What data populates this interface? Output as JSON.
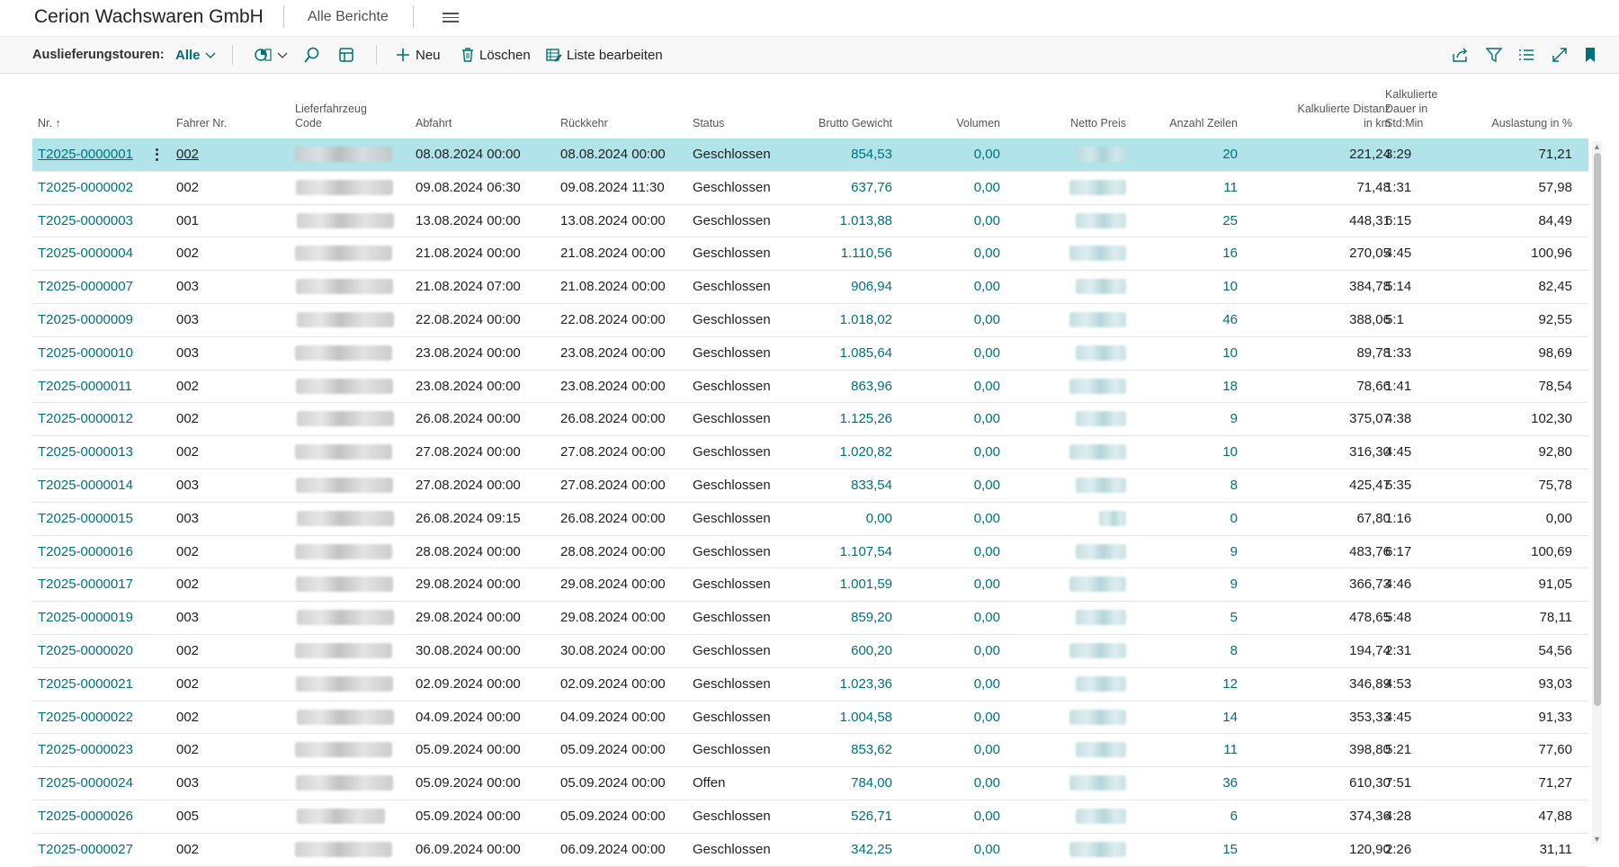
{
  "header": {
    "company": "Cerion Wachswaren GmbH",
    "reports_label": "Alle Berichte"
  },
  "actionbar": {
    "tours_label": "Auslieferungstouren:",
    "filter_value": "Alle",
    "new_label": "Neu",
    "delete_label": "Löschen",
    "edit_list_label": "Liste bearbeiten"
  },
  "columns": {
    "nr": "Nr.",
    "driver": "Fahrer Nr.",
    "vehicle_1": "Lieferfahrzeug",
    "vehicle_2": "Code",
    "departure": "Abfahrt",
    "return": "Rückkehr",
    "status": "Status",
    "gross_weight": "Brutto Gewicht",
    "volume": "Volumen",
    "net_price": "Netto Preis",
    "lines": "Anzahl Zeilen",
    "dist_1": "Kalkulierte Distanz",
    "dist_2": "in km",
    "dur_1": "Kalkulierte",
    "dur_2": "Dauer in",
    "dur_3": "Std:Min",
    "util": "Auslastung in %"
  },
  "rows": [
    {
      "nr": "T2025-0000001",
      "driver": "002",
      "dep": "08.08.2024 00:00",
      "ret": "08.08.2024 00:00",
      "status": "Geschlossen",
      "weight": "854,53",
      "vol": "0,00",
      "lines": "20",
      "dist": "221,24",
      "dur": "3:29",
      "util": "71,21"
    },
    {
      "nr": "T2025-0000002",
      "driver": "002",
      "dep": "09.08.2024 06:30",
      "ret": "09.08.2024 11:30",
      "status": "Geschlossen",
      "weight": "637,76",
      "vol": "0,00",
      "lines": "11",
      "dist": "71,48",
      "dur": "1:31",
      "util": "57,98"
    },
    {
      "nr": "T2025-0000003",
      "driver": "001",
      "dep": "13.08.2024 00:00",
      "ret": "13.08.2024 00:00",
      "status": "Geschlossen",
      "weight": "1.013,88",
      "vol": "0,00",
      "lines": "25",
      "dist": "448,31",
      "dur": "6:15",
      "util": "84,49"
    },
    {
      "nr": "T2025-0000004",
      "driver": "002",
      "dep": "21.08.2024 00:00",
      "ret": "21.08.2024 00:00",
      "status": "Geschlossen",
      "weight": "1.110,56",
      "vol": "0,00",
      "lines": "16",
      "dist": "270,05",
      "dur": "4:45",
      "util": "100,96"
    },
    {
      "nr": "T2025-0000007",
      "driver": "003",
      "dep": "21.08.2024 07:00",
      "ret": "21.08.2024 00:00",
      "status": "Geschlossen",
      "weight": "906,94",
      "vol": "0,00",
      "lines": "10",
      "dist": "384,78",
      "dur": "5:14",
      "util": "82,45"
    },
    {
      "nr": "T2025-0000009",
      "driver": "003",
      "dep": "22.08.2024 00:00",
      "ret": "22.08.2024 00:00",
      "status": "Geschlossen",
      "weight": "1.018,02",
      "vol": "0,00",
      "lines": "46",
      "dist": "388,06",
      "dur": "5:1",
      "util": "92,55"
    },
    {
      "nr": "T2025-0000010",
      "driver": "003",
      "dep": "23.08.2024 00:00",
      "ret": "23.08.2024 00:00",
      "status": "Geschlossen",
      "weight": "1.085,64",
      "vol": "0,00",
      "lines": "10",
      "dist": "89,78",
      "dur": "1:33",
      "util": "98,69"
    },
    {
      "nr": "T2025-0000011",
      "driver": "002",
      "dep": "23.08.2024 00:00",
      "ret": "23.08.2024 00:00",
      "status": "Geschlossen",
      "weight": "863,96",
      "vol": "0,00",
      "lines": "18",
      "dist": "78,66",
      "dur": "1:41",
      "util": "78,54"
    },
    {
      "nr": "T2025-0000012",
      "driver": "002",
      "dep": "26.08.2024 00:00",
      "ret": "26.08.2024 00:00",
      "status": "Geschlossen",
      "weight": "1.125,26",
      "vol": "0,00",
      "lines": "9",
      "dist": "375,07",
      "dur": "4:38",
      "util": "102,30"
    },
    {
      "nr": "T2025-0000013",
      "driver": "002",
      "dep": "27.08.2024 00:00",
      "ret": "27.08.2024 00:00",
      "status": "Geschlossen",
      "weight": "1.020,82",
      "vol": "0,00",
      "lines": "10",
      "dist": "316,30",
      "dur": "4:45",
      "util": "92,80"
    },
    {
      "nr": "T2025-0000014",
      "driver": "003",
      "dep": "27.08.2024 00:00",
      "ret": "27.08.2024 00:00",
      "status": "Geschlossen",
      "weight": "833,54",
      "vol": "0,00",
      "lines": "8",
      "dist": "425,47",
      "dur": "5:35",
      "util": "75,78"
    },
    {
      "nr": "T2025-0000015",
      "driver": "003",
      "dep": "26.08.2024 09:15",
      "ret": "26.08.2024 00:00",
      "status": "Geschlossen",
      "weight": "0,00",
      "vol": "0,00",
      "lines": "0",
      "dist": "67,80",
      "dur": "1:16",
      "util": "0,00"
    },
    {
      "nr": "T2025-0000016",
      "driver": "002",
      "dep": "28.08.2024 00:00",
      "ret": "28.08.2024 00:00",
      "status": "Geschlossen",
      "weight": "1.107,54",
      "vol": "0,00",
      "lines": "9",
      "dist": "483,76",
      "dur": "6:17",
      "util": "100,69"
    },
    {
      "nr": "T2025-0000017",
      "driver": "002",
      "dep": "29.08.2024 00:00",
      "ret": "29.08.2024 00:00",
      "status": "Geschlossen",
      "weight": "1.001,59",
      "vol": "0,00",
      "lines": "9",
      "dist": "366,73",
      "dur": "4:46",
      "util": "91,05"
    },
    {
      "nr": "T2025-0000019",
      "driver": "003",
      "dep": "29.08.2024 00:00",
      "ret": "29.08.2024 00:00",
      "status": "Geschlossen",
      "weight": "859,20",
      "vol": "0,00",
      "lines": "5",
      "dist": "478,65",
      "dur": "5:48",
      "util": "78,11"
    },
    {
      "nr": "T2025-0000020",
      "driver": "002",
      "dep": "30.08.2024 00:00",
      "ret": "30.08.2024 00:00",
      "status": "Geschlossen",
      "weight": "600,20",
      "vol": "0,00",
      "lines": "8",
      "dist": "194,74",
      "dur": "2:31",
      "util": "54,56"
    },
    {
      "nr": "T2025-0000021",
      "driver": "002",
      "dep": "02.09.2024 00:00",
      "ret": "02.09.2024 00:00",
      "status": "Geschlossen",
      "weight": "1.023,36",
      "vol": "0,00",
      "lines": "12",
      "dist": "346,89",
      "dur": "4:53",
      "util": "93,03"
    },
    {
      "nr": "T2025-0000022",
      "driver": "002",
      "dep": "04.09.2024 00:00",
      "ret": "04.09.2024 00:00",
      "status": "Geschlossen",
      "weight": "1.004,58",
      "vol": "0,00",
      "lines": "14",
      "dist": "353,33",
      "dur": "4:45",
      "util": "91,33"
    },
    {
      "nr": "T2025-0000023",
      "driver": "002",
      "dep": "05.09.2024 00:00",
      "ret": "05.09.2024 00:00",
      "status": "Geschlossen",
      "weight": "853,62",
      "vol": "0,00",
      "lines": "11",
      "dist": "398,80",
      "dur": "5:21",
      "util": "77,60"
    },
    {
      "nr": "T2025-0000024",
      "driver": "003",
      "dep": "05.09.2024 00:00",
      "ret": "05.09.2024 00:00",
      "status": "Offen",
      "weight": "784,00",
      "vol": "0,00",
      "lines": "36",
      "dist": "610,30",
      "dur": "7:51",
      "util": "71,27"
    },
    {
      "nr": "T2025-0000026",
      "driver": "005",
      "dep": "05.09.2024 00:00",
      "ret": "05.09.2024 00:00",
      "status": "Geschlossen",
      "weight": "526,71",
      "vol": "0,00",
      "lines": "6",
      "dist": "374,36",
      "dur": "4:28",
      "util": "47,88"
    },
    {
      "nr": "T2025-0000027",
      "driver": "002",
      "dep": "06.09.2024 00:00",
      "ret": "06.09.2024 00:00",
      "status": "Geschlossen",
      "weight": "342,25",
      "vol": "0,00",
      "lines": "15",
      "dist": "120,90",
      "dur": "2:26",
      "util": "31,11"
    }
  ],
  "colors": {
    "accent": "#00707a",
    "selected_row": "#b0e4e8"
  }
}
